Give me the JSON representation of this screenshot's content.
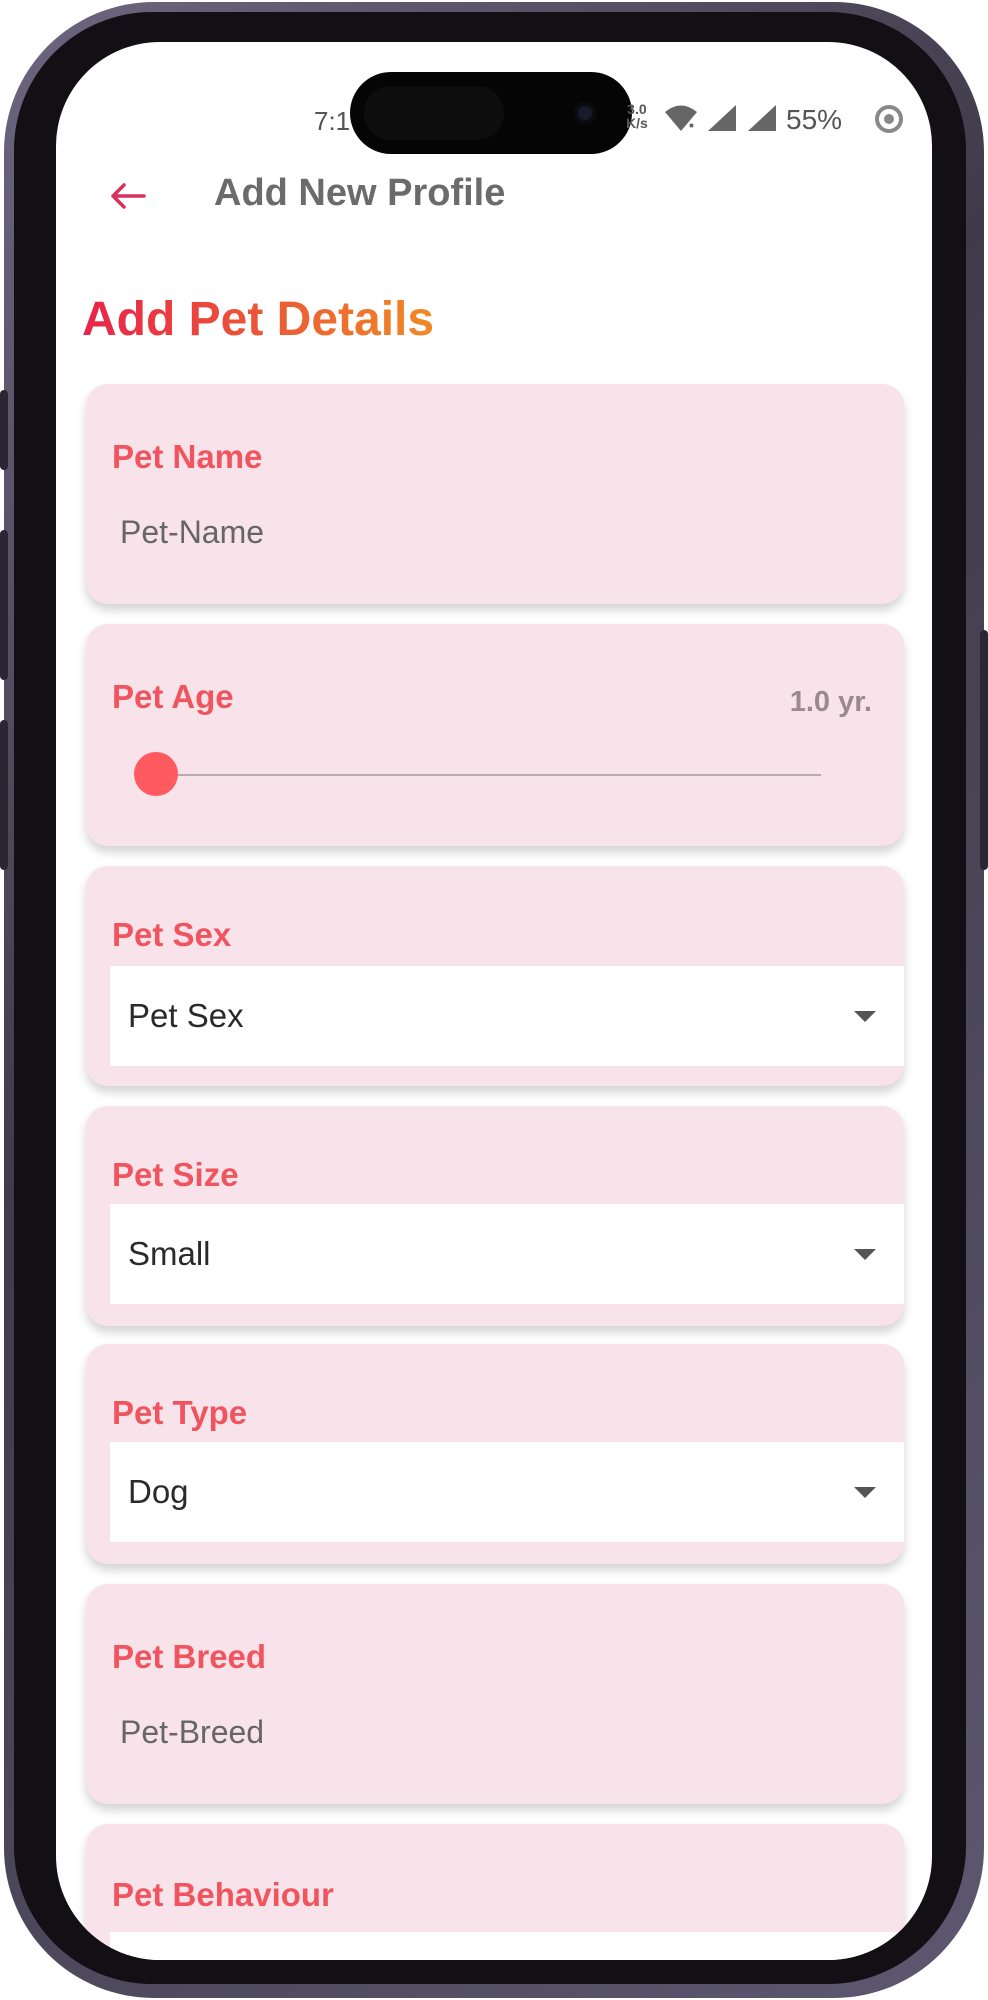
{
  "status_bar": {
    "time": "7:1",
    "net_speed_value": "3.0",
    "net_speed_unit": "K/s",
    "battery": "55%"
  },
  "header": {
    "back_icon": "arrow-left-icon",
    "title": "Add New Profile"
  },
  "page": {
    "title": "Add Pet Details"
  },
  "form": {
    "pet_name": {
      "label": "Pet Name",
      "placeholder": "Pet-Name"
    },
    "pet_age": {
      "label": "Pet Age",
      "display": "1.0 yr.",
      "value_fraction": 0.0
    },
    "pet_sex": {
      "label": "Pet Sex",
      "selected": "Pet Sex"
    },
    "pet_size": {
      "label": "Pet Size",
      "selected": "Small"
    },
    "pet_type": {
      "label": "Pet Type",
      "selected": "Dog"
    },
    "pet_breed": {
      "label": "Pet Breed",
      "placeholder": "Pet-Breed"
    },
    "pet_behaviour": {
      "label": "Pet Behaviour"
    }
  },
  "colors": {
    "accent": "#f0555f",
    "card_bg": "#f9e3ea",
    "title_gradient_start": "#e8234a",
    "title_gradient_end": "#f08a24",
    "slider": "#ff5a5f"
  }
}
